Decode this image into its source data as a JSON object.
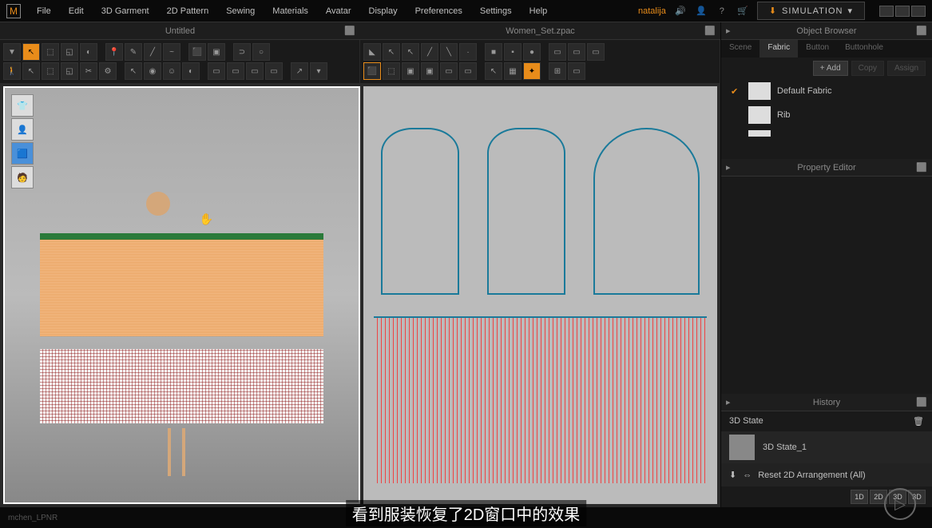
{
  "app_logo": "M",
  "menu": [
    "File",
    "Edit",
    "3D Garment",
    "2D Pattern",
    "Sewing",
    "Materials",
    "Avatar",
    "Display",
    "Preferences",
    "Settings",
    "Help"
  ],
  "username": "natalija",
  "simulation_label": "SIMULATION",
  "viewport_tabs": {
    "left": "Untitled",
    "right": "Women_Set.zpac"
  },
  "sidebar": {
    "object_browser": {
      "title": "Object Browser",
      "tabs": [
        "Scene",
        "Fabric",
        "Button",
        "Buttonhole"
      ],
      "active_tab": "Fabric",
      "add_label": "+ Add",
      "copy_label": "Copy",
      "assign_label": "Assign",
      "fabrics": [
        {
          "name": "Default Fabric",
          "checked": true
        },
        {
          "name": "Rib",
          "checked": false
        }
      ]
    },
    "property_editor": {
      "title": "Property Editor"
    },
    "history": {
      "title": "History",
      "state_label": "3D State",
      "items": [
        "3D State_1"
      ],
      "reset_label": "Reset 2D Arrangement (All)"
    },
    "modes": [
      "1D",
      "2D",
      "3D",
      "3D"
    ]
  },
  "subtitle": "看到服装恢复了2D窗口中的效果",
  "bottom_status": "mchen_LPNR"
}
